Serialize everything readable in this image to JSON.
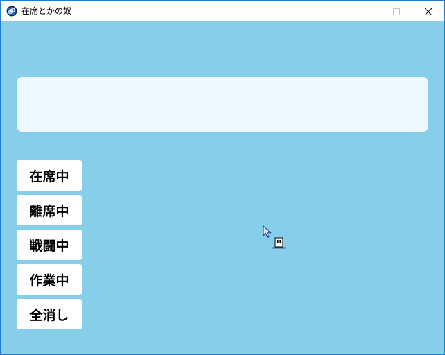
{
  "window": {
    "title": "在席とかの奴",
    "icon": "app-globe-icon",
    "controls": {
      "minimize": "minimize-icon",
      "maximize": "maximize-icon",
      "close": "close-icon"
    }
  },
  "display": {
    "status_text": ""
  },
  "buttons": [
    {
      "id": "present",
      "label": "在席中"
    },
    {
      "id": "away",
      "label": "離席中"
    },
    {
      "id": "battle",
      "label": "戦闘中"
    },
    {
      "id": "working",
      "label": "作業中"
    },
    {
      "id": "clear",
      "label": "全消し"
    }
  ],
  "colors": {
    "background": "#87ceeb",
    "panel": "#f0f8ff",
    "button": "#ffffff",
    "window_border": "#1c7fd6"
  }
}
